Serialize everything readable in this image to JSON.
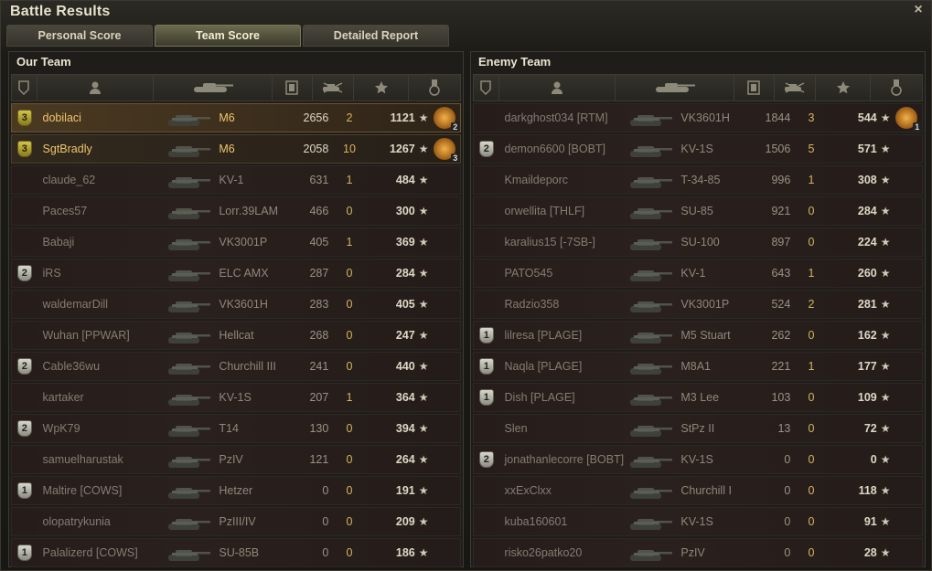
{
  "window": {
    "title": "Battle Results",
    "close_label": "×"
  },
  "tabs": [
    {
      "label": "Personal Score",
      "active": false
    },
    {
      "label": "Team Score",
      "active": true
    },
    {
      "label": "Detailed Report",
      "active": false
    }
  ],
  "columns": [
    "rank-icon",
    "player-icon",
    "tank-icon",
    "xp-icon",
    "kills-icon",
    "star-icon",
    "medal-icon"
  ],
  "star_glyph": "★",
  "our_team": {
    "title": "Our Team",
    "rows": [
      {
        "rank": "3",
        "rank_color": "gold",
        "name": "dobilaci",
        "vehicle": "M6",
        "xp": "2656",
        "kills": "2",
        "score": "1121",
        "medal": "2",
        "highlight": "hl"
      },
      {
        "rank": "3",
        "rank_color": "gold",
        "name": "SgtBradly",
        "vehicle": "M6",
        "xp": "2058",
        "kills": "10",
        "score": "1267",
        "medal": "3",
        "highlight": "hl2"
      },
      {
        "rank": "",
        "name": "claude_62",
        "vehicle": "KV-1",
        "xp": "631",
        "kills": "1",
        "score": "484",
        "medal": ""
      },
      {
        "rank": "",
        "name": "Paces57",
        "vehicle": "Lorr.39LAM",
        "xp": "466",
        "kills": "0",
        "score": "300",
        "medal": ""
      },
      {
        "rank": "",
        "name": "Babaji",
        "vehicle": "VK3001P",
        "xp": "405",
        "kills": "1",
        "score": "369",
        "medal": ""
      },
      {
        "rank": "2",
        "rank_color": "silver",
        "name": "iRS",
        "vehicle": "ELC AMX",
        "xp": "287",
        "kills": "0",
        "score": "284",
        "medal": ""
      },
      {
        "rank": "",
        "name": "waldemarDill",
        "vehicle": "VK3601H",
        "xp": "283",
        "kills": "0",
        "score": "405",
        "medal": ""
      },
      {
        "rank": "",
        "name": "Wuhan [PPWAR]",
        "vehicle": "Hellcat",
        "xp": "268",
        "kills": "0",
        "score": "247",
        "medal": ""
      },
      {
        "rank": "2",
        "rank_color": "silver",
        "name": "Cable36wu",
        "vehicle": "Churchill III",
        "xp": "241",
        "kills": "0",
        "score": "440",
        "medal": ""
      },
      {
        "rank": "",
        "name": "kartaker",
        "vehicle": "KV-1S",
        "xp": "207",
        "kills": "1",
        "score": "364",
        "medal": ""
      },
      {
        "rank": "2",
        "rank_color": "silver",
        "name": "WpK79",
        "vehicle": "T14",
        "xp": "130",
        "kills": "0",
        "score": "394",
        "medal": ""
      },
      {
        "rank": "",
        "name": "samuelharustak",
        "vehicle": "PzIV",
        "xp": "121",
        "kills": "0",
        "score": "264",
        "medal": ""
      },
      {
        "rank": "1",
        "rank_color": "silver",
        "name": "Maltire [COWS]",
        "vehicle": "Hetzer",
        "xp": "0",
        "kills": "0",
        "score": "191",
        "medal": ""
      },
      {
        "rank": "",
        "name": "olopatrykunia",
        "vehicle": "PzIII/IV",
        "xp": "0",
        "kills": "0",
        "score": "209",
        "medal": ""
      },
      {
        "rank": "1",
        "rank_color": "silver",
        "name": "Palalizerd [COWS]",
        "vehicle": "SU-85B",
        "xp": "0",
        "kills": "0",
        "score": "186",
        "medal": ""
      }
    ]
  },
  "enemy_team": {
    "title": "Enemy Team",
    "rows": [
      {
        "rank": "",
        "name": "darkghost034 [RTM]",
        "vehicle": "VK3601H",
        "xp": "1844",
        "kills": "3",
        "score": "544",
        "medal": "1"
      },
      {
        "rank": "2",
        "rank_color": "silver",
        "name": "demon6600 [BOBT]",
        "vehicle": "KV-1S",
        "xp": "1506",
        "kills": "5",
        "score": "571",
        "medal": ""
      },
      {
        "rank": "",
        "name": "Kmaildeporc",
        "vehicle": "T-34-85",
        "xp": "996",
        "kills": "1",
        "score": "308",
        "medal": ""
      },
      {
        "rank": "",
        "name": "orwellita [THLF]",
        "vehicle": "SU-85",
        "xp": "921",
        "kills": "0",
        "score": "284",
        "medal": ""
      },
      {
        "rank": "",
        "name": "karalius15 [-7SB-]",
        "vehicle": "SU-100",
        "xp": "897",
        "kills": "0",
        "score": "224",
        "medal": ""
      },
      {
        "rank": "",
        "name": "PATO545",
        "vehicle": "KV-1",
        "xp": "643",
        "kills": "1",
        "score": "260",
        "medal": ""
      },
      {
        "rank": "",
        "name": "Radzio358",
        "vehicle": "VK3001P",
        "xp": "524",
        "kills": "2",
        "score": "281",
        "medal": ""
      },
      {
        "rank": "1",
        "rank_color": "silver",
        "name": "lilresa [PLAGE]",
        "vehicle": "M5 Stuart",
        "xp": "262",
        "kills": "0",
        "score": "162",
        "medal": ""
      },
      {
        "rank": "1",
        "rank_color": "silver",
        "name": "Naqla [PLAGE]",
        "vehicle": "M8A1",
        "xp": "221",
        "kills": "1",
        "score": "177",
        "medal": ""
      },
      {
        "rank": "1",
        "rank_color": "silver",
        "name": "Dish [PLAGE]",
        "vehicle": "M3 Lee",
        "xp": "103",
        "kills": "0",
        "score": "109",
        "medal": ""
      },
      {
        "rank": "",
        "name": "Slen",
        "vehicle": "StPz II",
        "xp": "13",
        "kills": "0",
        "score": "72",
        "medal": ""
      },
      {
        "rank": "2",
        "rank_color": "silver",
        "name": "jonathanlecorre [BOBT]",
        "vehicle": "KV-1S",
        "xp": "0",
        "kills": "0",
        "score": "0",
        "medal": ""
      },
      {
        "rank": "",
        "name": "xxExClxx",
        "vehicle": "Churchill I",
        "xp": "0",
        "kills": "0",
        "score": "118",
        "medal": ""
      },
      {
        "rank": "",
        "name": "kuba160601",
        "vehicle": "KV-1S",
        "xp": "0",
        "kills": "0",
        "score": "91",
        "medal": ""
      },
      {
        "rank": "",
        "name": "risko26patko20",
        "vehicle": "PzIV",
        "xp": "0",
        "kills": "0",
        "score": "28",
        "medal": ""
      }
    ]
  }
}
